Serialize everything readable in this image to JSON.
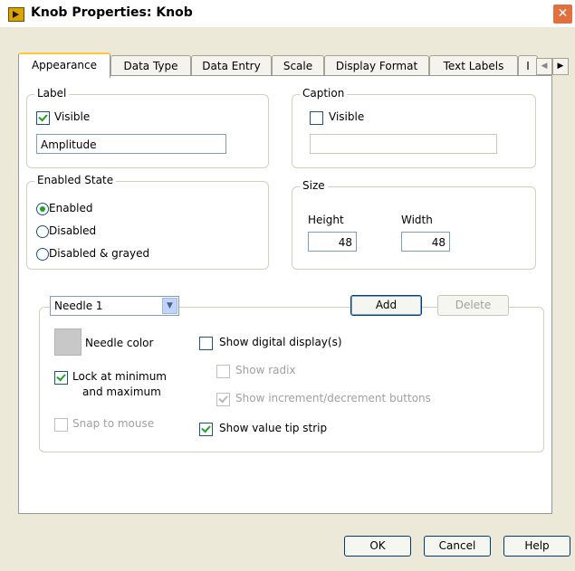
{
  "window": {
    "title": "Knob Properties: Knob"
  },
  "tabs": [
    "Appearance",
    "Data Type",
    "Data Entry",
    "Scale",
    "Display Format",
    "Text Labels",
    "I"
  ],
  "label_group": {
    "title": "Label",
    "visible_label": "Visible",
    "visible_checked": true,
    "value": "Amplitude"
  },
  "caption_group": {
    "title": "Caption",
    "visible_label": "Visible",
    "visible_checked": false,
    "value": ""
  },
  "enabled_group": {
    "title": "Enabled State",
    "options": [
      "Enabled",
      "Disabled",
      "Disabled & grayed"
    ],
    "selected": "Enabled"
  },
  "size_group": {
    "title": "Size",
    "height_label": "Height",
    "width_label": "Width",
    "height": "48",
    "width": "48"
  },
  "needle": {
    "selected": "Needle 1",
    "add_label": "Add",
    "delete_label": "Delete",
    "color_label": "Needle color",
    "lock_label_line1": "Lock at minimum",
    "lock_label_line2": "and maximum",
    "snap_label": "Snap to mouse",
    "show_digital_label": "Show digital display(s)",
    "show_radix_label": "Show radix",
    "show_incdec_label": "Show increment/decrement buttons",
    "show_tip_label": "Show value tip strip"
  },
  "footer": {
    "ok": "OK",
    "cancel": "Cancel",
    "help": "Help"
  }
}
